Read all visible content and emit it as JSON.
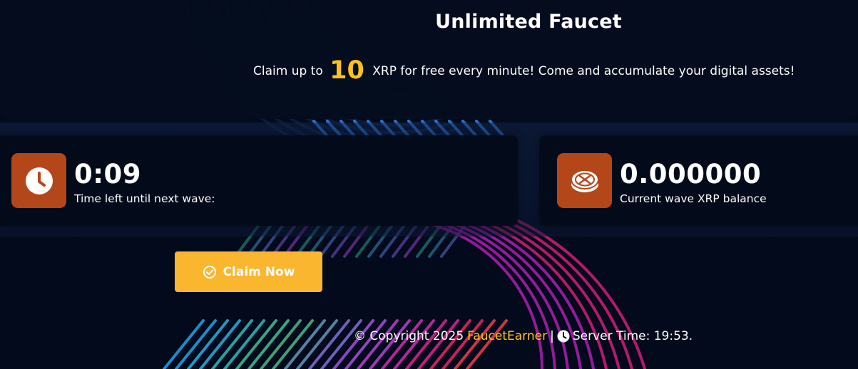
{
  "hero": {
    "title": "Unlimited Faucet",
    "subtitle_prefix": "Claim up to",
    "amount": "10",
    "subtitle_suffix": "XRP for free every minute! Come and accumulate your digital assets!"
  },
  "timer_card": {
    "value": "0:09",
    "label": "Time left until next wave:",
    "icon": "clock-icon"
  },
  "balance_card": {
    "value": "0.000000",
    "label": "Current wave XRP balance",
    "icon": "xrp-coin-icon"
  },
  "claim_button": {
    "label": "Claim Now",
    "icon": "check-circle-icon"
  },
  "footer": {
    "copyright": "© Copyright 2025",
    "brand": "FaucetEarner",
    "separator": "|",
    "server_time": "Server Time: 19:53.",
    "icon": "clock-icon"
  },
  "colors": {
    "background": "#020a1c",
    "accent": "#ffc21a",
    "button": "#fbb62f",
    "icon_tile": "#b3471a"
  }
}
